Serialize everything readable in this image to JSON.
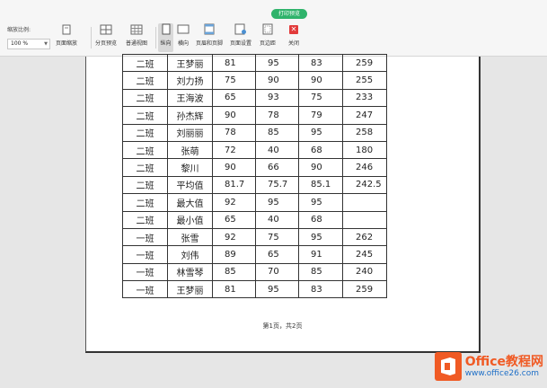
{
  "toolbar": {
    "tab_badge": "打印预览",
    "zoom_label": "缩放比例:",
    "zoom_value": "100 %",
    "buttons": {
      "page_zoom": "页面缩放",
      "page_break_preview": "分页预览",
      "normal_view": "普通视图",
      "portrait": "纵向",
      "landscape": "横向",
      "header_footer": "页眉和页脚",
      "page_setup": "页面设置",
      "margins": "页边距",
      "close": "关闭"
    }
  },
  "table": {
    "rows": [
      [
        "二班",
        "王梦丽",
        "81",
        "95",
        "83",
        "259"
      ],
      [
        "二班",
        "刘力扬",
        "75",
        "90",
        "90",
        "255"
      ],
      [
        "二班",
        "王海波",
        "65",
        "93",
        "75",
        "233"
      ],
      [
        "二班",
        "孙杰辉",
        "90",
        "78",
        "79",
        "247"
      ],
      [
        "二班",
        "刘丽丽",
        "78",
        "85",
        "95",
        "258"
      ],
      [
        "二班",
        "张萌",
        "72",
        "40",
        "68",
        "180"
      ],
      [
        "二班",
        "黎川",
        "90",
        "66",
        "90",
        "246"
      ],
      [
        "二班",
        "平均值",
        "81.7",
        "75.7",
        "85.1",
        "242.5"
      ],
      [
        "二班",
        "最大值",
        "92",
        "95",
        "95",
        ""
      ],
      [
        "二班",
        "最小值",
        "65",
        "40",
        "68",
        ""
      ],
      [
        "一班",
        "张雪",
        "92",
        "75",
        "95",
        "262"
      ],
      [
        "一班",
        "刘伟",
        "89",
        "65",
        "91",
        "245"
      ],
      [
        "一班",
        "林雪琴",
        "85",
        "70",
        "85",
        "240"
      ],
      [
        "一班",
        "王梦丽",
        "81",
        "95",
        "83",
        "259"
      ]
    ]
  },
  "footer": "第1页，共2页",
  "watermark": {
    "line1": "Office教程网",
    "line2": "www.office26.com"
  },
  "colors": {
    "badge": "#2fb36b",
    "close": "#e23b3b",
    "watermark_orange": "#f05a24",
    "watermark_blue": "#1e6fc7"
  }
}
